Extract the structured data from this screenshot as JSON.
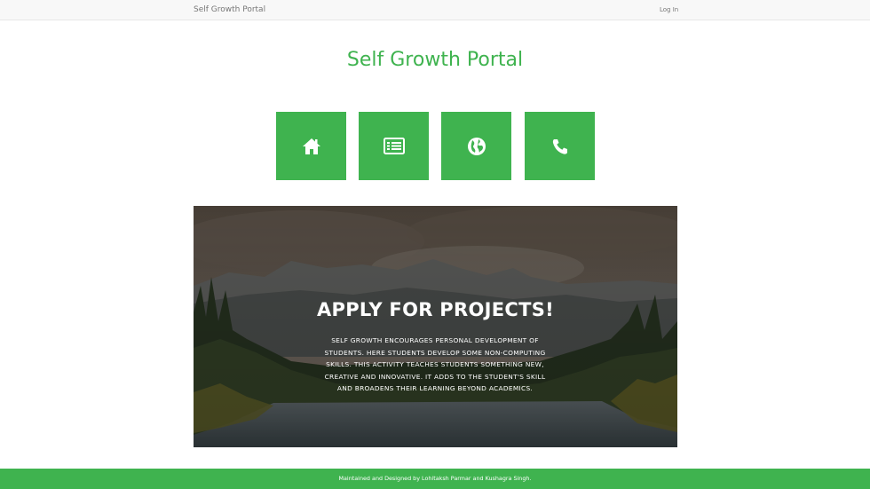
{
  "navbar": {
    "brand": "Self Growth Portal",
    "login": "Log In"
  },
  "page_title": "Self Growth Portal",
  "tiles": [
    {
      "icon": "home-icon"
    },
    {
      "icon": "list-icon"
    },
    {
      "icon": "globe-icon"
    },
    {
      "icon": "phone-icon"
    }
  ],
  "hero": {
    "title": "APPLY FOR PROJECTS!",
    "text": "SELF GROWTH ENCOURAGES PERSONAL DEVELOPMENT OF STUDENTS. HERE STUDENTS DEVELOP SOME NON-COMPUTING SKILLS. THIS ACTIVITY TEACHES STUDENTS SOMETHING NEW, CREATIVE AND INNOVATIVE. IT ADDS TO THE STUDENT'S SKILL AND BROADENS THEIR LEARNING BEYOND ACADEMICS."
  },
  "footer": {
    "text": "Maintained and Designed by Lohitaksh Parmar and Kushagra Singh."
  },
  "colors": {
    "accent": "#3fb34f",
    "navbar_bg": "#f8f8f8"
  }
}
